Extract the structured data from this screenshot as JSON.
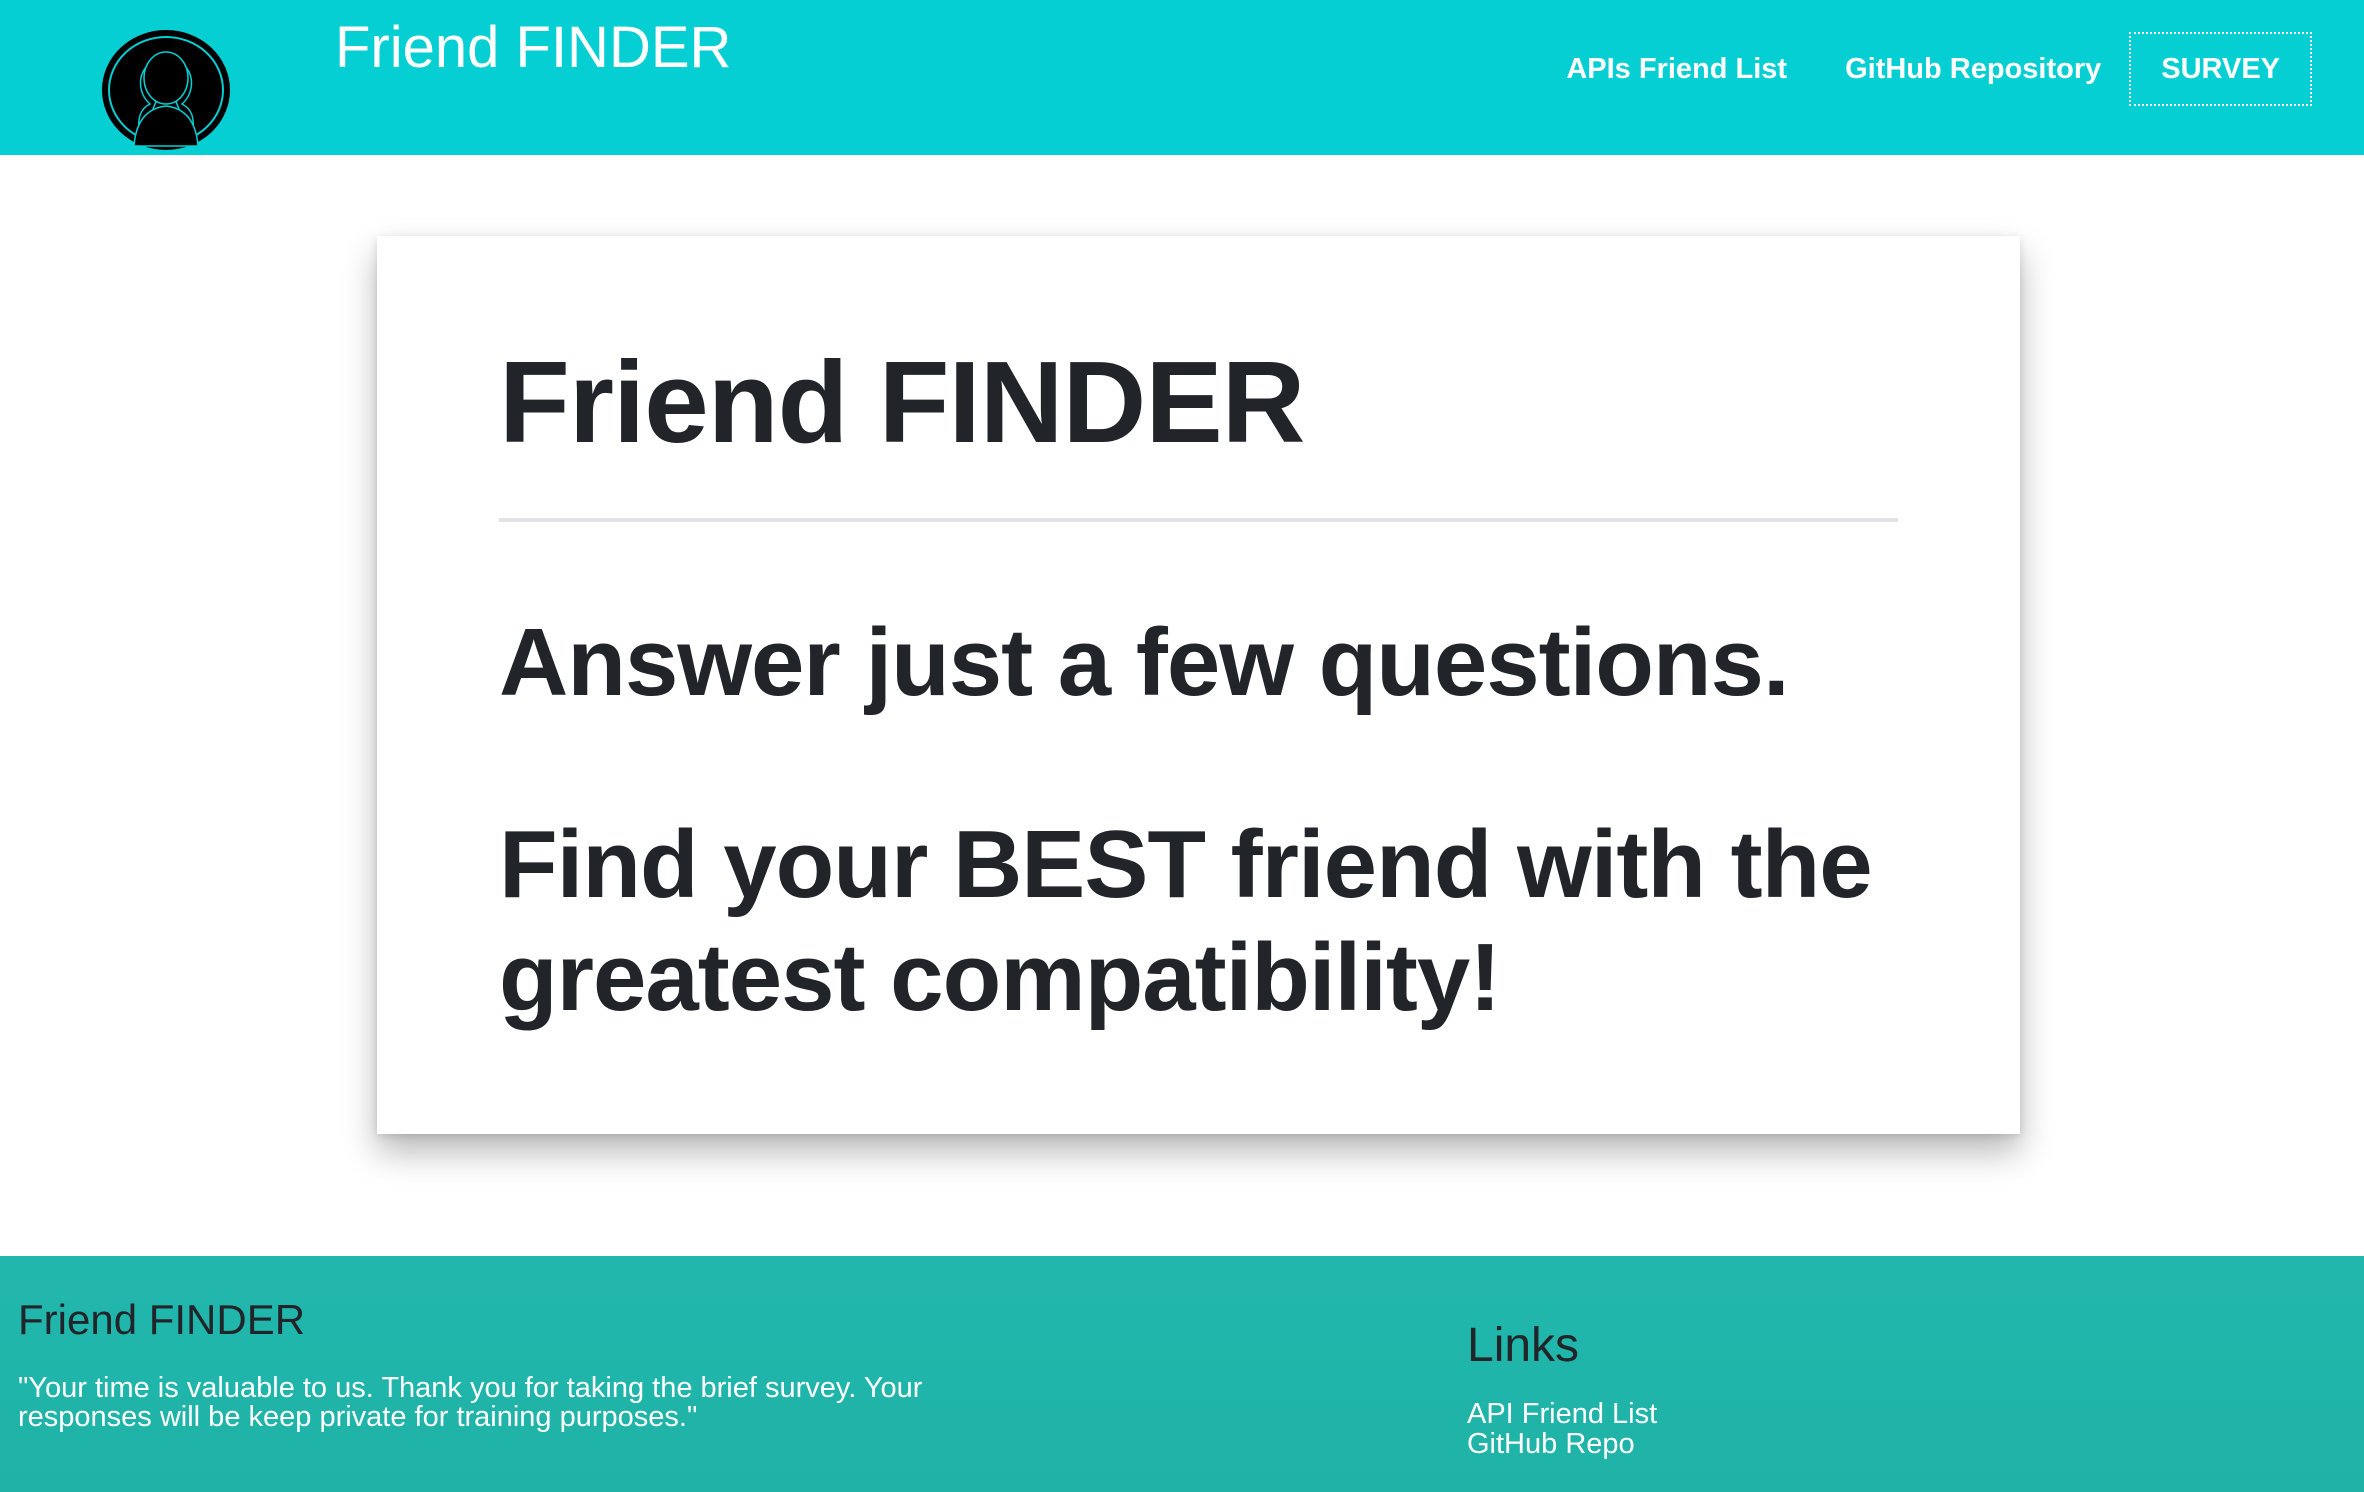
{
  "header": {
    "brand": "Friend FINDER",
    "nav": {
      "api_list": "APIs Friend List",
      "github": "GitHub Repository",
      "survey": "SURVEY"
    }
  },
  "jumbotron": {
    "title": "Friend FINDER",
    "line1": "Answer just a few questions.",
    "line2": "Find your BEST friend with the greatest compatibility!"
  },
  "footer": {
    "brand": "Friend FINDER",
    "quote": "\"Your time is valuable to us. Thank you for taking the brief survey. Your responses will be keep private for training purposes.\"",
    "links_heading": "Links",
    "links": {
      "api": "API Friend List",
      "github": "GitHub Repo"
    }
  },
  "colors": {
    "navbar": "#05cfd2",
    "footer": "#22b7ad",
    "text_dark": "#212529",
    "text_light": "#ffffff"
  },
  "icons": {
    "logo": "people-silhouette-icon"
  }
}
